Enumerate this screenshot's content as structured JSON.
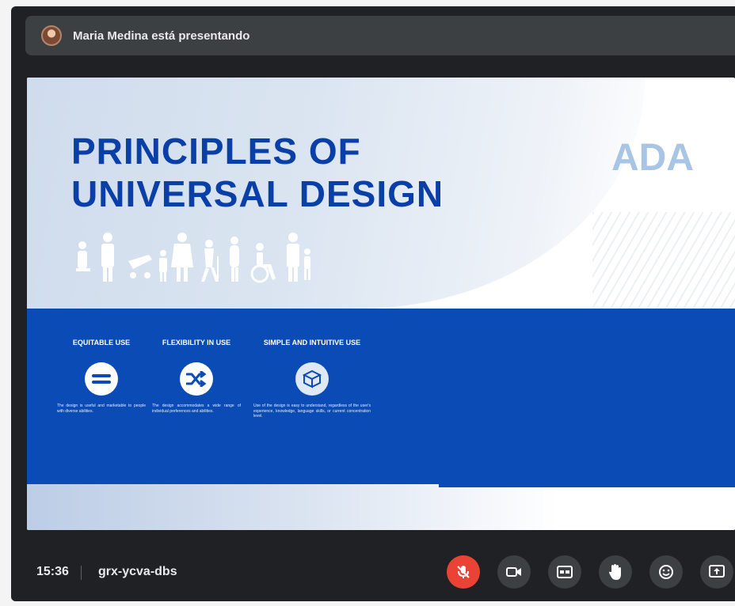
{
  "presenter": {
    "text": "Maria Medina está presentando"
  },
  "slide": {
    "title_line1": "PRINCIPLES OF",
    "title_line2": "UNIVERSAL DESIGN",
    "side_label": "ADA",
    "principles": [
      {
        "title": "EQUITABLE USE",
        "icon": "equals-icon",
        "description": "The design is useful and marketable to people with diverse abilities."
      },
      {
        "title": "FLEXIBILITY IN USE",
        "icon": "shuffle-icon",
        "description": "The design accommodates a wide range of individual preferences and abilities."
      },
      {
        "title": "SIMPLE AND INTUITIVE USE",
        "icon": "cube-icon",
        "description": "Use of the design is easy to understand, regardless of the user's experience, knowledge, language skills, or current concentration level."
      }
    ]
  },
  "meeting": {
    "time": "15:36",
    "code": "grx-ycva-dbs"
  },
  "controls": [
    {
      "name": "microphone-off-button",
      "icon": "mic-off-icon",
      "state": "muted"
    },
    {
      "name": "camera-button",
      "icon": "video-camera-icon"
    },
    {
      "name": "captions-button",
      "icon": "closed-captions-icon"
    },
    {
      "name": "raise-hand-button",
      "icon": "hand-icon"
    },
    {
      "name": "emoji-button",
      "icon": "emoji-icon"
    },
    {
      "name": "present-button",
      "icon": "present-screen-icon"
    }
  ],
  "colors": {
    "slide_blue": "#0a4bb5",
    "title_blue": "#0a3fa8",
    "mute_red": "#ea4335",
    "meet_dark": "#202124"
  }
}
